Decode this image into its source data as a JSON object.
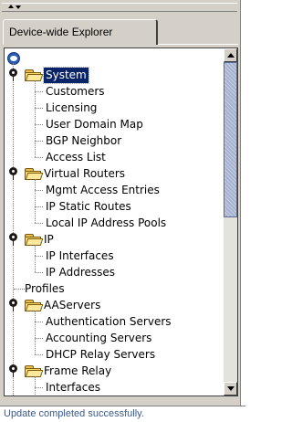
{
  "tab": {
    "label": "Device-wide Explorer"
  },
  "tree": {
    "root_icon": "network-globe-icon",
    "nodes": [
      {
        "label": "System",
        "level": 1,
        "folder": true,
        "expanded": true,
        "selected": true
      },
      {
        "label": "Customers",
        "level": 2
      },
      {
        "label": "Licensing",
        "level": 2
      },
      {
        "label": "User Domain Map",
        "level": 2
      },
      {
        "label": "BGP Neighbor",
        "level": 2
      },
      {
        "label": "Access List",
        "level": 2
      },
      {
        "label": "Virtual Routers",
        "level": 1,
        "folder": true,
        "expanded": true
      },
      {
        "label": "Mgmt Access Entries",
        "level": 2
      },
      {
        "label": "IP Static Routes",
        "level": 2
      },
      {
        "label": "Local IP Address Pools",
        "level": 2
      },
      {
        "label": "IP",
        "level": 1,
        "folder": true,
        "expanded": true
      },
      {
        "label": "IP Interfaces",
        "level": 2
      },
      {
        "label": "IP Addresses",
        "level": 2
      },
      {
        "label": "Profiles",
        "level": 1
      },
      {
        "label": "AAServers",
        "level": 1,
        "folder": true,
        "expanded": true
      },
      {
        "label": "Authentication Servers",
        "level": 2
      },
      {
        "label": "Accounting Servers",
        "level": 2
      },
      {
        "label": "DHCP Relay Servers",
        "level": 2
      },
      {
        "label": "Frame Relay",
        "level": 1,
        "folder": true,
        "expanded": true
      },
      {
        "label": "Interfaces",
        "level": 2
      }
    ]
  },
  "status": {
    "text": "Update completed successfully."
  },
  "colors": {
    "selection": "#0a246a",
    "status_text": "#3c5a8a",
    "scroll_thumb": "#a7b2cf"
  }
}
